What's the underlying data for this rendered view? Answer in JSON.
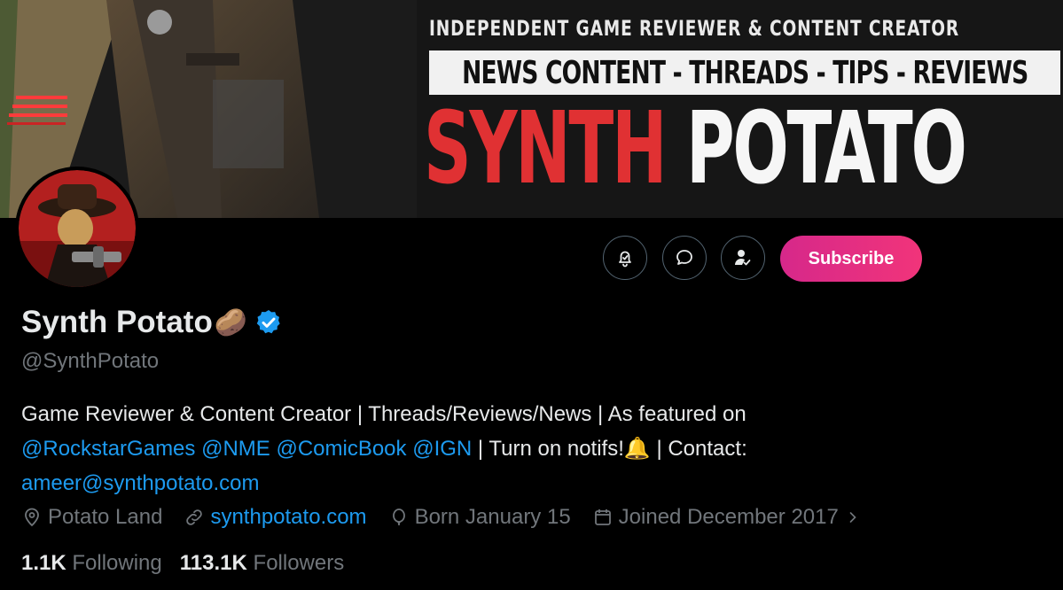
{
  "banner": {
    "tagline": "INDEPENDENT GAME REVIEWER & CONTENT CREATOR",
    "strip": "NEWS CONTENT - THREADS - TIPS - REVIEWS",
    "title_red": "SYNTH",
    "title_white": "POTATO"
  },
  "actions": {
    "subscribe_label": "Subscribe",
    "notify_icon": "bell-plus-icon",
    "message_icon": "chat-bubble-icon",
    "following_icon": "person-check-icon"
  },
  "profile": {
    "display_name": "Synth Potato",
    "name_emoji": "🥔",
    "verified_icon": "verified-badge-icon",
    "handle": "@SynthPotato",
    "bio": {
      "line1": "Game Reviewer & Content Creator | Threads/Reviews/News | As featured on",
      "mention1": "@RockstarGames",
      "mention2": "@NME",
      "mention3": "@ComicBook",
      "mention4": "@IGN",
      "after_mentions": " | Turn on notifs!",
      "bell_emoji": "🔔",
      "contact_label": " | Contact:",
      "email": "ameer@synthpotato.com"
    },
    "location": "Potato Land",
    "website": "synthpotato.com",
    "birthday": "Born January 15",
    "joined": "Joined December 2017",
    "following_count": "1.1K",
    "following_label": "Following",
    "followers_count": "113.1K",
    "followers_label": "Followers"
  },
  "colors": {
    "accent": "#1d9bf0",
    "subscribe_gradient_start": "#d6288a",
    "subscribe_gradient_end": "#f1347a",
    "banner_red": "#e03133"
  }
}
